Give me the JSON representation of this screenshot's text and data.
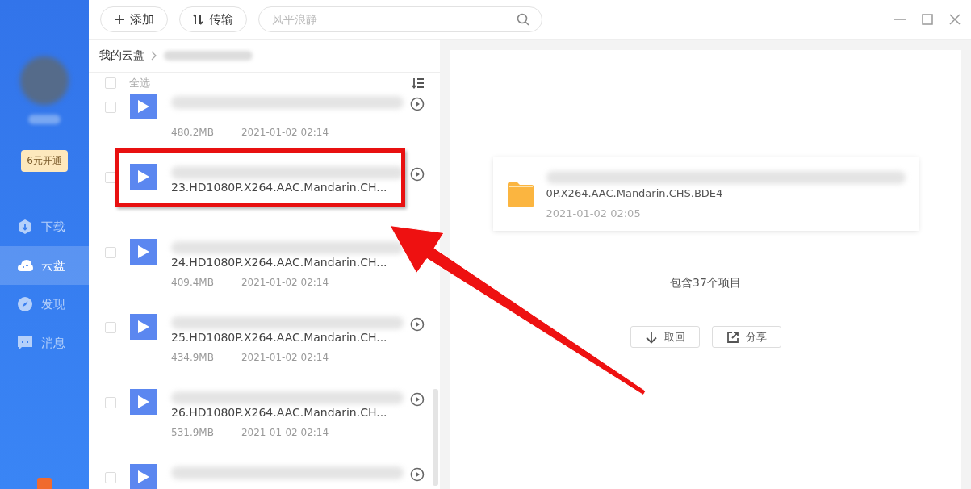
{
  "sidebar": {
    "vip_button": "6元开通",
    "nav": [
      {
        "kind": "download",
        "label": "下载",
        "selected": false
      },
      {
        "kind": "cloud",
        "label": "云盘",
        "selected": true
      },
      {
        "kind": "discover",
        "label": "发现",
        "selected": false
      },
      {
        "kind": "message",
        "label": "消息",
        "selected": false
      }
    ]
  },
  "toolbar": {
    "add_button": "添加",
    "transfer_button": "传输",
    "search": {
      "placeholder": "风平浪静"
    }
  },
  "breadcrumb": {
    "root": "我的云盘"
  },
  "file_list": {
    "select_all": {
      "label": "全选",
      "checked": false
    },
    "files": [
      {
        "size": "480.2MB",
        "date": "2021-01-02 02:14",
        "checked": false,
        "play_icon": true
      },
      {
        "name": "23.HD1080P.X264.AAC.Mandarin.CH...",
        "checked": false,
        "play_icon": true,
        "highlighted": true
      },
      {
        "name": "24.HD1080P.X264.AAC.Mandarin.CH...",
        "size": "409.4MB",
        "date": "2021-01-02 02:14",
        "checked": false,
        "play_icon": false
      },
      {
        "name": "25.HD1080P.X264.AAC.Mandarin.CH...",
        "size": "434.9MB",
        "date": "2021-01-02 02:14",
        "checked": false,
        "play_icon": true
      },
      {
        "name": "26.HD1080P.X264.AAC.Mandarin.CH...",
        "size": "531.9MB",
        "date": "2021-01-02 02:14",
        "checked": false,
        "play_icon": true
      },
      {
        "checked": false,
        "play_icon": true
      }
    ]
  },
  "details": {
    "folder_name": "0P.X264.AAC.Mandarin.CHS.BDE4",
    "date": "2021-01-02 02:05",
    "summary": "包含37个项目",
    "buttons": [
      {
        "kind": "retrieve",
        "label": "取回"
      },
      {
        "kind": "share",
        "label": "分享"
      }
    ]
  }
}
